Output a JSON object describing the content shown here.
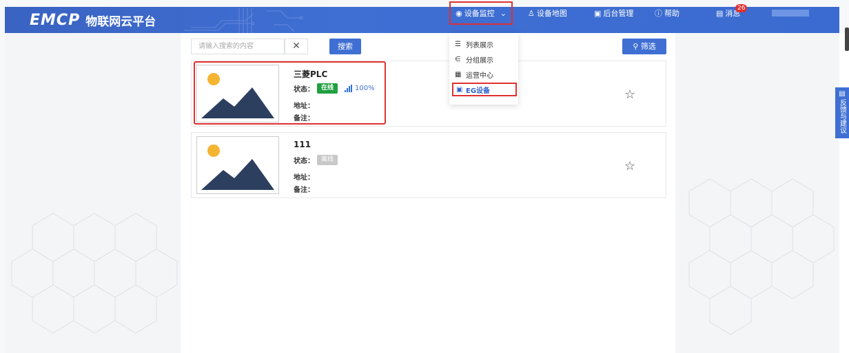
{
  "header": {
    "logo_mark": "EMCP",
    "logo_text": "物联网云平台",
    "nav": {
      "monitor": "设备监控",
      "map": "设备地图",
      "admin": "后台管理",
      "help": "帮助",
      "messages": "消息",
      "message_count": "26"
    }
  },
  "dropdown": {
    "items": [
      "列表展示",
      "分组展示",
      "运营中心",
      "EG设备"
    ]
  },
  "search": {
    "placeholder": "请输入搜索的内容",
    "clear_label": "✕",
    "search_label": "搜索",
    "filter_label": "筛选"
  },
  "labels": {
    "status": "状态：",
    "address": "地址：",
    "note": "备注："
  },
  "devices": [
    {
      "name": "三菱PLC",
      "status": "在线",
      "signal": "100%",
      "address": "",
      "note": ""
    },
    {
      "name": "111",
      "status": "离线",
      "address": "",
      "note": ""
    }
  ],
  "feedback": "反馈与建议",
  "colors": {
    "brand_blue": "#3f6fd3",
    "online_green": "#20a040",
    "offline_gray": "#c8c8c8",
    "highlight_red": "#e03030",
    "thumb_sun": "#f4b533",
    "thumb_mountain": "#2d3f5f"
  }
}
